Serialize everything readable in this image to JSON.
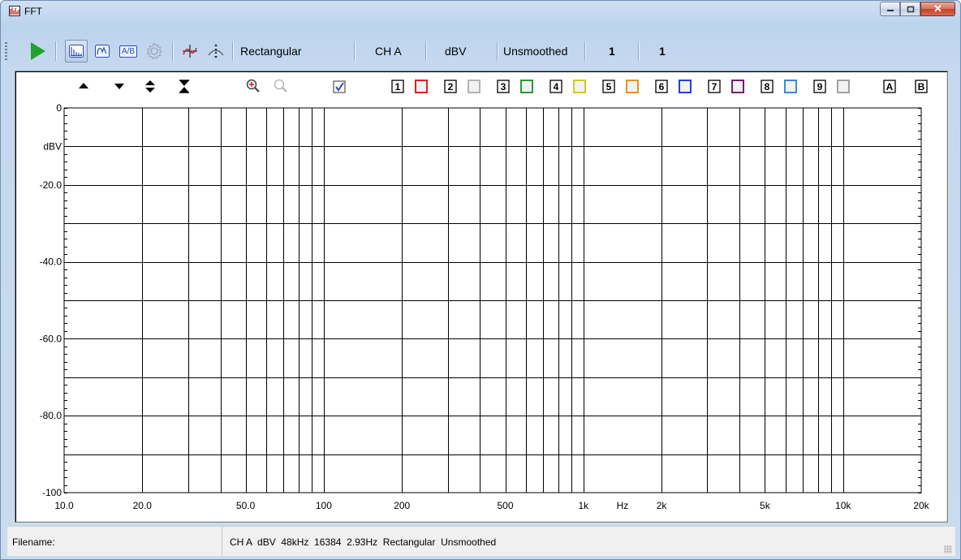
{
  "window": {
    "title": "FFT",
    "minimize_glyph": "–",
    "maximize_glyph": "▫",
    "close_glyph": "✕"
  },
  "toolbar": {
    "ab_label": "A/B",
    "window_type": "Rectangular",
    "channel": "CH A",
    "units": "dBV",
    "smoothing": "Unsmoothed",
    "average_1": "1",
    "average_2": "1"
  },
  "plot_toolbar": {
    "channel_numbers": [
      "1",
      "2",
      "3",
      "4",
      "5",
      "6",
      "7",
      "8",
      "9"
    ],
    "channel_colors": [
      "#e02020",
      "#b4b4b4",
      "#2a9a30",
      "#d0cc20",
      "#f09020",
      "#2040e0",
      "#7a1a7a",
      "#3a8cd8",
      "#a0a0a0"
    ],
    "channel_checked": [
      false,
      false,
      false,
      false,
      false,
      false,
      false,
      false,
      false
    ],
    "master_checked": true,
    "cursor_a": "A",
    "cursor_b": "B"
  },
  "chart_data": {
    "type": "line",
    "xscale": "log",
    "xlim": [
      10,
      20000
    ],
    "ylim": [
      -100,
      0
    ],
    "x_tick_values": [
      10,
      20,
      50,
      100,
      200,
      500,
      1000,
      2000,
      5000,
      10000,
      20000
    ],
    "x_tick_labels": [
      "10.0",
      "20.0",
      "50.0",
      "100",
      "200",
      "500",
      "1k",
      "2k",
      "5k",
      "10k",
      "20k"
    ],
    "x_unit_label": "Hz",
    "y_tick_values": [
      0,
      -20,
      -40,
      -60,
      -80,
      -100
    ],
    "y_tick_labels": [
      "0",
      "-20.0",
      "-40.0",
      "-60.0",
      "-80.0",
      "-100"
    ],
    "y_unit_label": "dBV",
    "grid": true,
    "series": []
  },
  "status": {
    "filename_label": "Filename:",
    "info": "CH A  dBV  48kHz  16384  2.93Hz  Rectangular  Unsmoothed"
  }
}
